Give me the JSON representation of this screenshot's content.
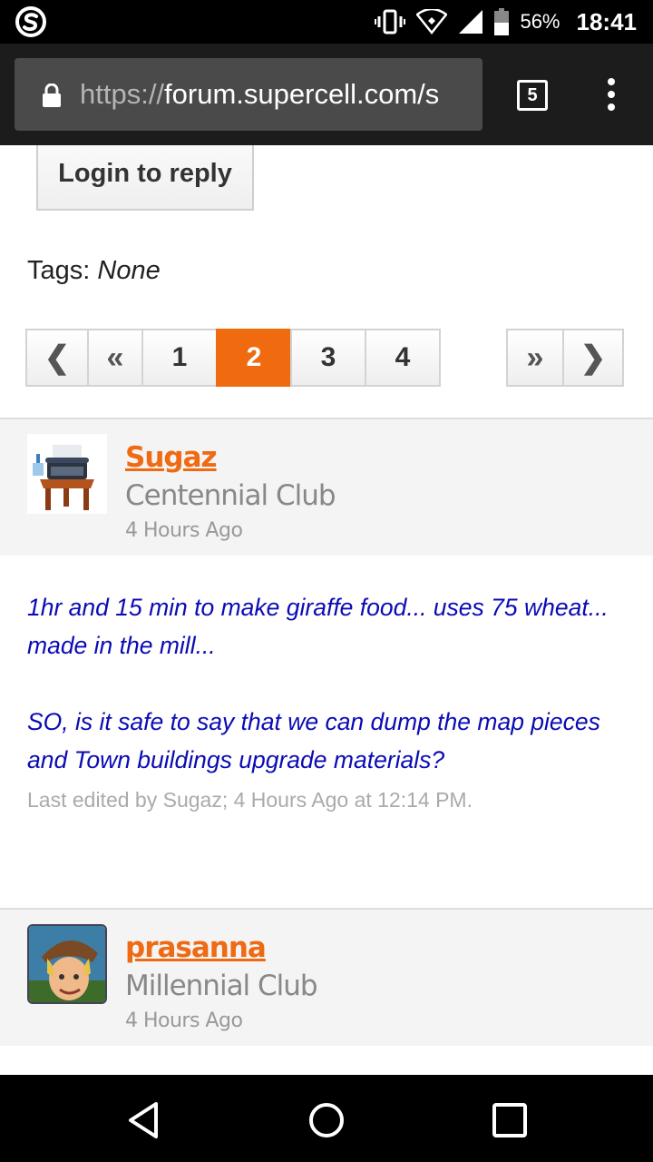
{
  "status_bar": {
    "battery_percent": "56%",
    "time": "18:41",
    "icons": [
      "vibrate-icon",
      "wifi-icon",
      "signal-icon",
      "battery-icon"
    ]
  },
  "browser": {
    "url_scheme": "https://",
    "url_host": "forum.supercell.com/s",
    "tab_count": "5"
  },
  "actions": {
    "login_to_reply": "Login to reply"
  },
  "tags": {
    "label": "Tags:",
    "value": "None"
  },
  "pagination": {
    "first_glyph": "❮",
    "prev_glyph": "«",
    "pages": [
      "1",
      "2",
      "3",
      "4"
    ],
    "current_page": "2",
    "next_glyph": "»",
    "last_glyph": "❯"
  },
  "posts": [
    {
      "username": "Sugaz",
      "rank": "Centennial Club",
      "date": "4 Hours Ago",
      "body": [
        "1hr and 15 min to make giraffe food... uses 75 wheat... made in the mill...",
        "SO, is it safe to say that we can dump the map pieces and Town buildings upgrade materials?"
      ],
      "edited": "Last edited by Sugaz; 4 Hours Ago at 12:14 PM."
    },
    {
      "username": "prasanna",
      "rank": "Millennial Club",
      "date": "4 Hours Ago"
    }
  ],
  "colors": {
    "accent": "#f06a0f",
    "post_text": "#0b0bb5"
  }
}
